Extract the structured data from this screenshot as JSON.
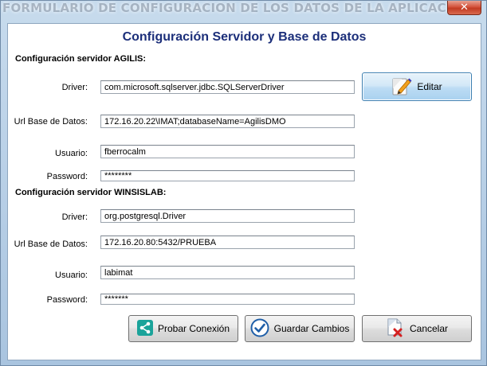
{
  "window": {
    "title": "FORMULARIO DE CONFIGURACION DE LOS DATOS DE LA APLICACION",
    "close_label": "✕"
  },
  "heading": "Configuración Servidor y Base de Datos",
  "agilis": {
    "section_title": "Configuración servidor AGILIS:",
    "driver_label": "Driver:",
    "driver_value": "com.microsoft.sqlserver.jdbc.SQLServerDriver",
    "url_label": "Url Base de Datos:",
    "url_value": "172.16.20.22\\IMAT;databaseName=AgilisDMO",
    "user_label": "Usuario:",
    "user_value": "fberrocalm",
    "password_label": "Password:",
    "password_value": "********"
  },
  "winsislab": {
    "section_title": "Configuración servidor WINSISLAB:",
    "driver_label": "Driver:",
    "driver_value": "org.postgresql.Driver",
    "url_label": "Url Base de Datos:",
    "url_value": "172.16.20.80:5432/PRUEBA",
    "user_label": "Usuario:",
    "user_value": "labimat",
    "password_label": "Password:",
    "password_value": "*******"
  },
  "buttons": {
    "edit": "Editar",
    "test": "Probar Conexión",
    "save": "Guardar Cambios",
    "cancel": "Cancelar"
  },
  "icons": {
    "edit": "edit-pencil-icon",
    "test": "share-icon",
    "save": "checkmark-icon",
    "cancel": "document-cancel-icon"
  },
  "colors": {
    "heading": "#1c2f7a",
    "test_icon_bg": "#1aa39a",
    "save_icon": "#1f5fa8",
    "cancel_x": "#d42020"
  }
}
